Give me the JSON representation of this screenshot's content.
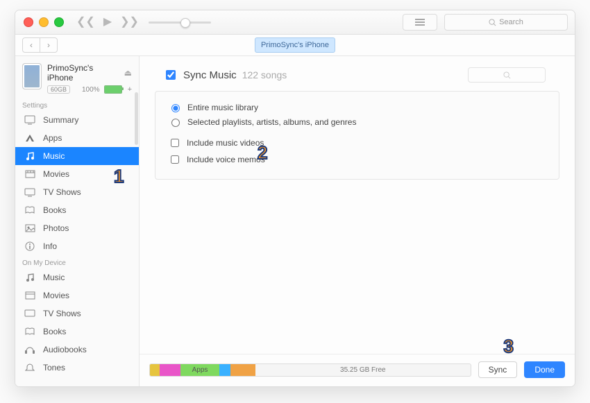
{
  "toolbar": {
    "search_placeholder": "Search"
  },
  "device_tab": "PrimoSync's iPhone",
  "device": {
    "name": "PrimoSync's iPhone",
    "capacity": "60GB",
    "battery_pct": "100%"
  },
  "sidebar": {
    "settings_header": "Settings",
    "settings": [
      "Summary",
      "Apps",
      "Music",
      "Movies",
      "TV Shows",
      "Books",
      "Photos",
      "Info"
    ],
    "device_header": "On My Device",
    "device_items": [
      "Music",
      "Movies",
      "TV Shows",
      "Books",
      "Audiobooks",
      "Tones"
    ]
  },
  "pane": {
    "sync_label": "Sync Music",
    "song_count": "122 songs",
    "radio_entire": "Entire music library",
    "radio_selected": "Selected playlists, artists, albums, and genres",
    "chk_videos": "Include music videos",
    "chk_memos": "Include voice memos"
  },
  "footer": {
    "apps_label": "Apps",
    "free_label": "35.25 GB Free",
    "sync_btn": "Sync",
    "done_btn": "Done"
  },
  "annotations": {
    "n1": "1",
    "n2": "2",
    "n3": "3"
  }
}
